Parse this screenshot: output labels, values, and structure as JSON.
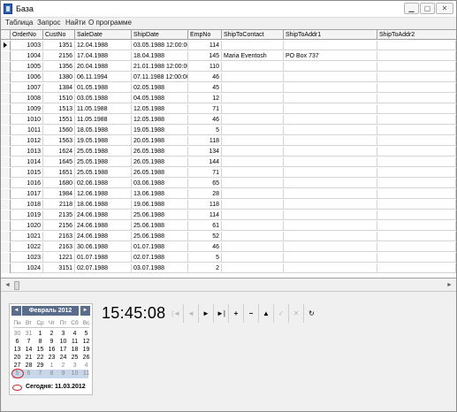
{
  "window": {
    "title": "База"
  },
  "menu": [
    "Таблица",
    "Запрос",
    "Найти",
    "О программе"
  ],
  "grid": {
    "columns": [
      "OrderNo",
      "CustNo",
      "SaleDate",
      "ShipDate",
      "EmpNo",
      "ShipToContact",
      "ShipToAddr1",
      "ShipToAddr2"
    ],
    "rows": [
      [
        "1003",
        "1351",
        "12.04.1988",
        "03.05.1988 12:00:00",
        "114",
        "",
        "",
        ""
      ],
      [
        "1004",
        "2156",
        "17.04.1988",
        "18.04.1988",
        "145",
        "Maria Eventosh",
        "PO Box 737",
        ""
      ],
      [
        "1005",
        "1356",
        "20.04.1988",
        "21.01.1988 12:00:00",
        "110",
        "",
        "",
        ""
      ],
      [
        "1006",
        "1380",
        "06.11.1994",
        "07.11.1988 12:00:00",
        "46",
        "",
        "",
        ""
      ],
      [
        "1007",
        "1384",
        "01.05.1988",
        "02.05.1988",
        "45",
        "",
        "",
        ""
      ],
      [
        "1008",
        "1510",
        "03.05.1988",
        "04.05.1988",
        "12",
        "",
        "",
        ""
      ],
      [
        "1009",
        "1513",
        "11.05.1988",
        "12.05.1988",
        "71",
        "",
        "",
        ""
      ],
      [
        "1010",
        "1551",
        "11.05.1988",
        "12.05.1988",
        "46",
        "",
        "",
        ""
      ],
      [
        "1011",
        "1560",
        "18.05.1988",
        "19.05.1988",
        "5",
        "",
        "",
        ""
      ],
      [
        "1012",
        "1563",
        "19.05.1988",
        "20.05.1988",
        "118",
        "",
        "",
        ""
      ],
      [
        "1013",
        "1624",
        "25.05.1988",
        "26.05.1988",
        "134",
        "",
        "",
        ""
      ],
      [
        "1014",
        "1645",
        "25.05.1988",
        "26.05.1988",
        "144",
        "",
        "",
        ""
      ],
      [
        "1015",
        "1651",
        "25.05.1988",
        "26.05.1988",
        "71",
        "",
        "",
        ""
      ],
      [
        "1016",
        "1680",
        "02.06.1988",
        "03.06.1988",
        "65",
        "",
        "",
        ""
      ],
      [
        "1017",
        "1984",
        "12.06.1988",
        "13.06.1988",
        "28",
        "",
        "",
        ""
      ],
      [
        "1018",
        "2118",
        "18.06.1988",
        "19.06.1988",
        "118",
        "",
        "",
        ""
      ],
      [
        "1019",
        "2135",
        "24.06.1988",
        "25.06.1988",
        "114",
        "",
        "",
        ""
      ],
      [
        "1020",
        "2156",
        "24.06.1988",
        "25.06.1988",
        "61",
        "",
        "",
        ""
      ],
      [
        "1021",
        "2163",
        "24.06.1988",
        "25.06.1988",
        "52",
        "",
        "",
        ""
      ],
      [
        "1022",
        "2163",
        "30.06.1988",
        "01.07.1988",
        "46",
        "",
        "",
        ""
      ],
      [
        "1023",
        "1221",
        "01.07.1988",
        "02.07.1988",
        "5",
        "",
        "",
        ""
      ],
      [
        "1024",
        "3151",
        "02.07.1988",
        "03.07.1988",
        "2",
        "",
        "",
        ""
      ]
    ]
  },
  "calendar": {
    "title": "Февраль 2012",
    "weekdays": [
      "Пн",
      "Вт",
      "Ср",
      "Чт",
      "Пт",
      "Сб",
      "Вс"
    ],
    "weeks": [
      [
        "30",
        "31",
        "1",
        "2",
        "3",
        "4",
        "5"
      ],
      [
        "6",
        "7",
        "8",
        "9",
        "10",
        "11",
        "12"
      ],
      [
        "13",
        "14",
        "15",
        "16",
        "17",
        "18",
        "19"
      ],
      [
        "20",
        "21",
        "22",
        "23",
        "24",
        "25",
        "26"
      ],
      [
        "27",
        "28",
        "29",
        "1",
        "2",
        "3",
        "4"
      ],
      [
        "5",
        "6",
        "7",
        "8",
        "9",
        "10",
        "11"
      ]
    ],
    "today_label": "Сегодня: 11.03.2012"
  },
  "clock": "15:45:08",
  "navigator": [
    "|◄",
    "◄",
    "►",
    "►|",
    "+",
    "−",
    "▲",
    "✓",
    "✕",
    "↻"
  ]
}
